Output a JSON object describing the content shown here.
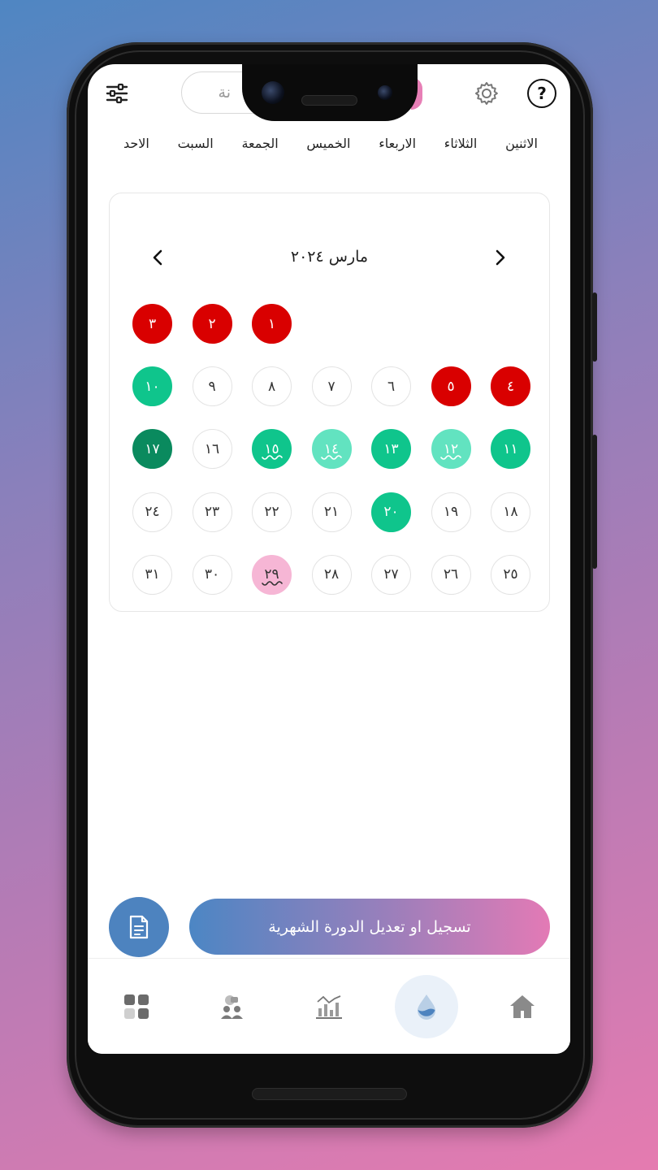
{
  "header": {
    "search_placeholder": "نة",
    "help_label": "?"
  },
  "weekdays": [
    "الاثنين",
    "الثلاثاء",
    "الاربعاء",
    "الخميس",
    "الجمعة",
    "السبت",
    "الاحد"
  ],
  "calendar": {
    "month_label": "مارس ٢٠٢٤",
    "days": [
      {
        "label": "",
        "status": "empty"
      },
      {
        "label": "",
        "status": "empty"
      },
      {
        "label": "",
        "status": "empty"
      },
      {
        "label": "",
        "status": "empty"
      },
      {
        "label": "١",
        "status": "red"
      },
      {
        "label": "٢",
        "status": "red"
      },
      {
        "label": "٣",
        "status": "red"
      },
      {
        "label": "٤",
        "status": "red"
      },
      {
        "label": "٥",
        "status": "red"
      },
      {
        "label": "٦",
        "status": "none"
      },
      {
        "label": "٧",
        "status": "none"
      },
      {
        "label": "٨",
        "status": "none"
      },
      {
        "label": "٩",
        "status": "none"
      },
      {
        "label": "١٠",
        "status": "green"
      },
      {
        "label": "١١",
        "status": "green"
      },
      {
        "label": "١٢",
        "status": "light-green",
        "wave": true
      },
      {
        "label": "١٣",
        "status": "green"
      },
      {
        "label": "١٤",
        "status": "light-green",
        "wave": true
      },
      {
        "label": "١٥",
        "status": "green",
        "wave": true
      },
      {
        "label": "١٦",
        "status": "none"
      },
      {
        "label": "١٧",
        "status": "dark-green"
      },
      {
        "label": "١٨",
        "status": "none"
      },
      {
        "label": "١٩",
        "status": "none"
      },
      {
        "label": "٢٠",
        "status": "green"
      },
      {
        "label": "٢١",
        "status": "none"
      },
      {
        "label": "٢٢",
        "status": "none"
      },
      {
        "label": "٢٣",
        "status": "none"
      },
      {
        "label": "٢٤",
        "status": "none"
      },
      {
        "label": "٢٥",
        "status": "none"
      },
      {
        "label": "٢٦",
        "status": "none"
      },
      {
        "label": "٢٧",
        "status": "none"
      },
      {
        "label": "٢٨",
        "status": "none"
      },
      {
        "label": "٢٩",
        "status": "pink",
        "wave": true
      },
      {
        "label": "٣٠",
        "status": "none"
      },
      {
        "label": "٣١",
        "status": "none"
      }
    ]
  },
  "actions": {
    "cta_label": "تسجيل او تعديل الدورة الشهرية",
    "fab_icon": "document-icon"
  },
  "tabs": [
    {
      "icon": "grid-icon",
      "active": false
    },
    {
      "icon": "community-icon",
      "active": false
    },
    {
      "icon": "chart-icon",
      "active": false
    },
    {
      "icon": "drop-icon",
      "active": true
    },
    {
      "icon": "home-icon",
      "active": false
    }
  ],
  "colors": {
    "red": "#d90000",
    "green": "#0fc58c",
    "light_green": "#62e3c0",
    "dark_green": "#0a8a5e",
    "pink": "#f6b6d5",
    "accent_blue": "#4d83bf"
  }
}
